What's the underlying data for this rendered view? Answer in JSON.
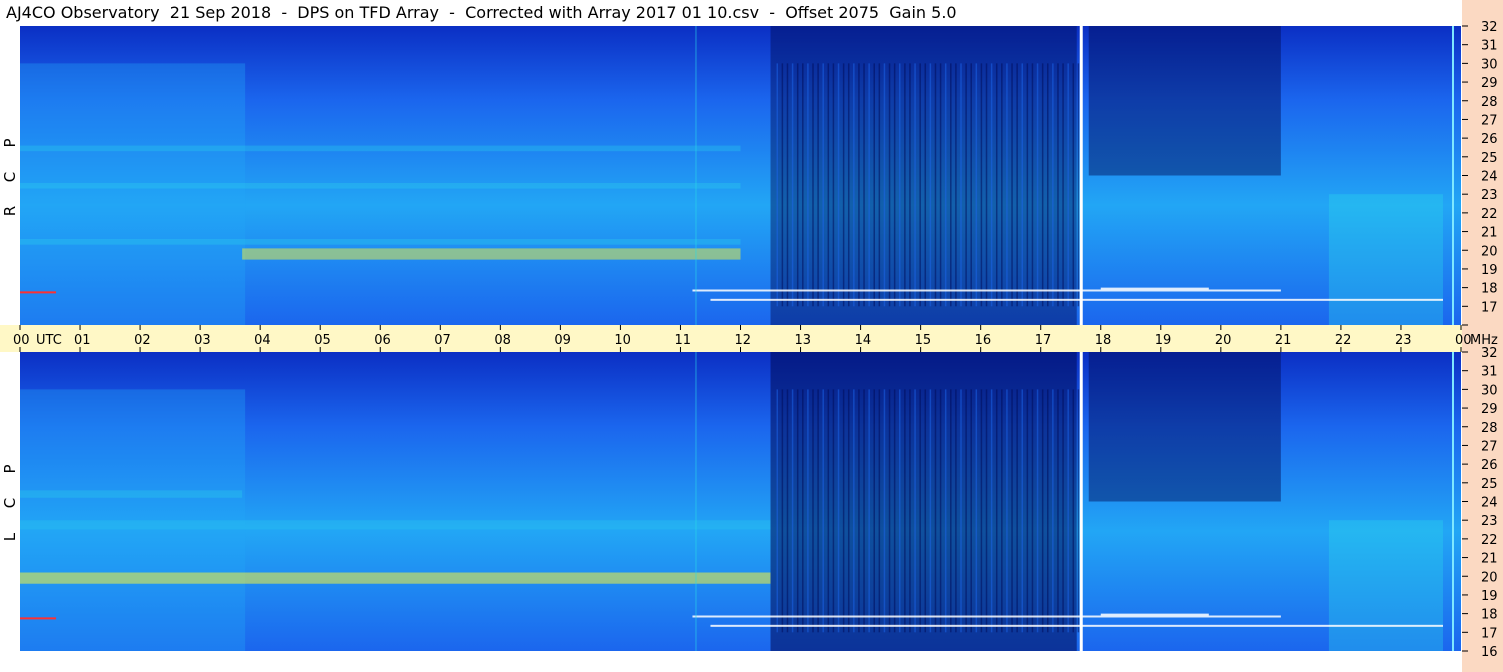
{
  "title": "AJ4CO Observatory  21 Sep 2018  -  DPS on TFD Array  -  Corrected with Array 2017 01 10.csv  -  Offset 2075  Gain 5.0",
  "chart_data": {
    "type": "heatmap",
    "x_axis": {
      "unit": "UTC",
      "ticks": [
        "00",
        "01",
        "02",
        "03",
        "04",
        "05",
        "06",
        "07",
        "08",
        "09",
        "10",
        "11",
        "12",
        "13",
        "14",
        "15",
        "16",
        "17",
        "18",
        "19",
        "20",
        "21",
        "22",
        "23",
        "00"
      ],
      "range": [
        0,
        24
      ]
    },
    "y_axis": {
      "unit": "MHz",
      "range": [
        16,
        32
      ],
      "ticks": [
        "16",
        "17",
        "18",
        "19",
        "20",
        "21",
        "22",
        "23",
        "24",
        "25",
        "26",
        "27",
        "28",
        "29",
        "30",
        "31",
        "32"
      ]
    },
    "panels": [
      {
        "name": "R C P",
        "letters": [
          "P",
          "C",
          "R"
        ]
      },
      {
        "name": "L C P",
        "letters": [
          "P",
          "C",
          "L"
        ]
      }
    ],
    "colors": {
      "deep": "#000a55",
      "dark": "#0b2fc4",
      "mid": "#1b66ee",
      "light": "#22a6f5",
      "cyan": "#2ad8ea",
      "yellow": "#f6f43a",
      "band": "#fff8c6",
      "strip": "#fbd9c2"
    }
  }
}
